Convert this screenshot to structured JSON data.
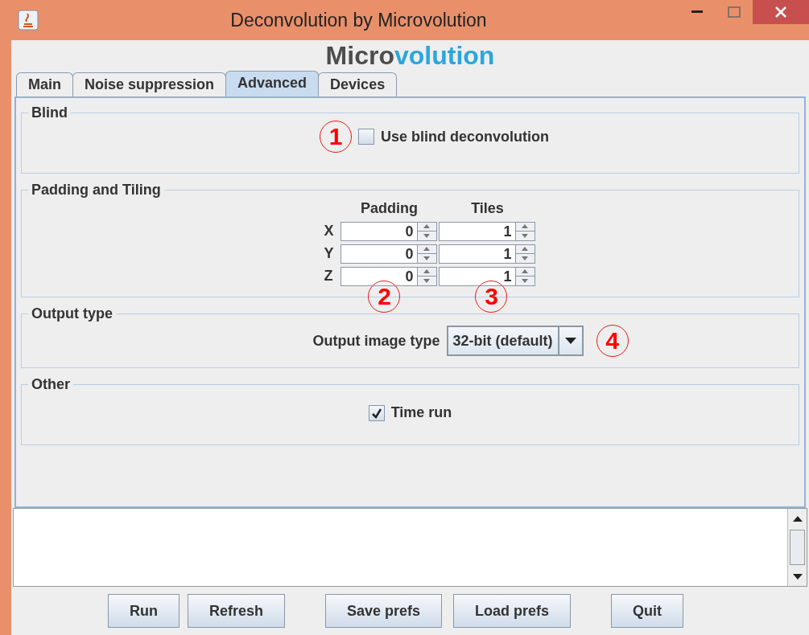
{
  "window": {
    "title": "Deconvolution by Microvolution"
  },
  "logo": {
    "parts": [
      {
        "text": "Micro",
        "color": "#4d4d4d"
      },
      {
        "text": "volution",
        "color": "#2aa6de"
      }
    ]
  },
  "tabs": [
    {
      "label": "Main",
      "selected": false
    },
    {
      "label": "Noise suppression",
      "selected": false
    },
    {
      "label": "Advanced",
      "selected": true
    },
    {
      "label": "Devices",
      "selected": false
    }
  ],
  "blind": {
    "title": "Blind",
    "callout": "1",
    "checkbox": {
      "label": "Use blind deconvolution",
      "checked": false
    }
  },
  "padding_tiling": {
    "title": "Padding and Tiling",
    "columns": [
      "Padding",
      "Tiles"
    ],
    "rows": [
      {
        "label": "X",
        "values": [
          "0",
          "1"
        ]
      },
      {
        "label": "Y",
        "values": [
          "0",
          "1"
        ]
      },
      {
        "label": "Z",
        "values": [
          "0",
          "1"
        ]
      }
    ],
    "callouts": [
      "2",
      "3"
    ]
  },
  "output_type": {
    "title": "Output type",
    "label": "Output image type",
    "value": "32-bit (default)",
    "callout": "4"
  },
  "other": {
    "title": "Other",
    "checkbox": {
      "label": "Time run",
      "checked": true
    }
  },
  "buttons": [
    "Run",
    "Refresh",
    "Save prefs",
    "Load prefs",
    "Quit"
  ]
}
